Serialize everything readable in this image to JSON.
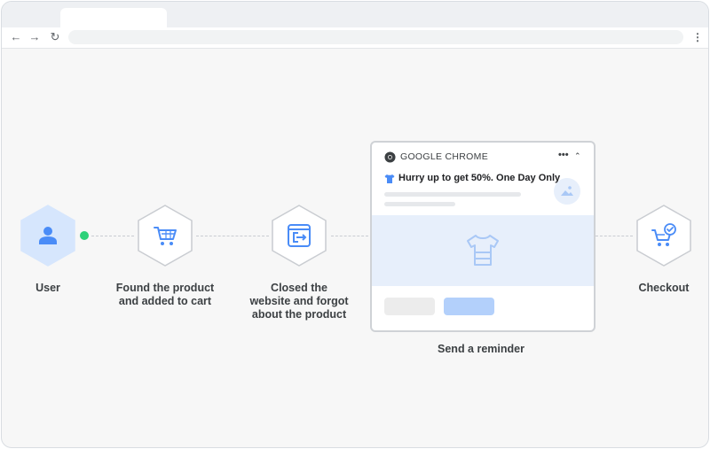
{
  "browser": {
    "nav_icons": [
      "back-arrow-icon",
      "forward-arrow-icon",
      "reload-icon",
      "more-vert-icon"
    ],
    "back_glyph": "←",
    "forward_glyph": "→",
    "reload_glyph": "↻",
    "menu_glyph": "⋮"
  },
  "flow": {
    "steps": [
      {
        "label": "User",
        "icon": "user-icon"
      },
      {
        "label": "Found the product\nand added to cart",
        "icon": "cart-icon"
      },
      {
        "label": "Closed the\nwebsite and forgot\nabout the product",
        "icon": "exit-window-icon"
      },
      {
        "label": "Send a reminder",
        "icon": "notification-card"
      },
      {
        "label": "Checkout",
        "icon": "cart-check-icon"
      }
    ]
  },
  "notification": {
    "app_name": "GOOGLE CHROME",
    "more_glyph": "•••",
    "collapse_glyph": "⌃",
    "title": "Hurry up to get 50%. One Day Only"
  },
  "colors": {
    "accent": "#4a8cf7",
    "hex_border": "#c9ccd1",
    "user_hex_fill": "#d6e6fd",
    "online_dot": "#2ed179",
    "primary_button": "#b3d0fb",
    "hero_bg": "#e7effb"
  }
}
